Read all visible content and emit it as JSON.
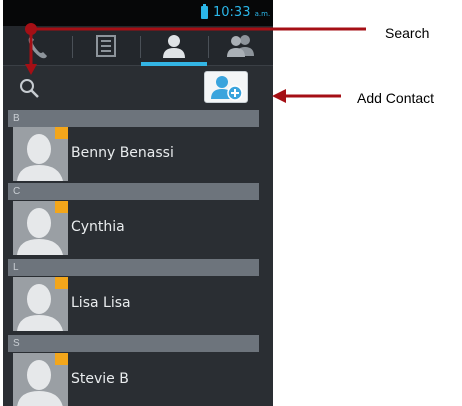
{
  "status_bar": {
    "time": "10:33",
    "ampm": "a.m."
  },
  "tabs": [
    {
      "name": "phone-tab",
      "icon": "phone-icon"
    },
    {
      "name": "call-log-tab",
      "icon": "list-icon"
    },
    {
      "name": "contacts-tab",
      "icon": "person-icon",
      "selected": true
    },
    {
      "name": "groups-tab",
      "icon": "group-icon"
    }
  ],
  "toolbar": {
    "search_icon": "search-icon",
    "add_contact_icon": "add-contact-icon"
  },
  "contacts": [
    {
      "section": "B",
      "name": "Benny Benassi"
    },
    {
      "section": "C",
      "name": "Cynthia"
    },
    {
      "section": "L",
      "name": "Lisa Lisa"
    },
    {
      "section": "S",
      "name": "Stevie B"
    }
  ],
  "callouts": {
    "search": "Search",
    "add_contact": "Add Contact"
  },
  "colors": {
    "accent": "#33b5e5",
    "callout": "#a50f15",
    "contact_badge": "#f3a61b"
  }
}
